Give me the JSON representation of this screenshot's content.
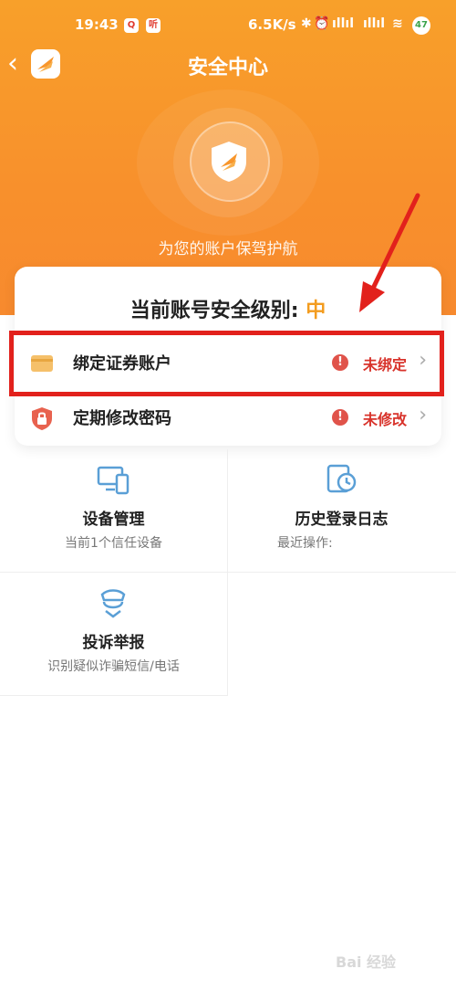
{
  "status_bar": {
    "time": "19:43",
    "badge_a": "Q",
    "badge_b": "听",
    "network_speed": "6.5K/s",
    "icons": [
      "bluetooth-icon",
      "alarm-icon",
      "signal-icon",
      "signal-icon",
      "wifi-icon"
    ],
    "battery": "47"
  },
  "nav": {
    "title": "安全中心",
    "back_icon": "chevron-left-icon"
  },
  "hero": {
    "subtitle": "为您的账户保驾护航"
  },
  "security_level": {
    "label": "当前账号安全级别: ",
    "value": "中"
  },
  "rows": [
    {
      "label": "绑定证券账户",
      "status": "未绑定",
      "icon": "card-icon"
    },
    {
      "label": "定期修改密码",
      "status": "未修改",
      "icon": "lock-shield-icon"
    }
  ],
  "grid": [
    {
      "title": "设备管理",
      "subtitle": "当前1个信任设备",
      "icon": "devices-icon"
    },
    {
      "title": "历史登录日志",
      "subtitle": "最近操作:",
      "icon": "history-clock-icon"
    },
    {
      "title": "投诉举报",
      "subtitle": "识别疑似诈骗短信/电话",
      "icon": "police-badge-icon"
    }
  ],
  "watermark": "Bai 经验",
  "colors": {
    "brand_orange": "#f8962c",
    "level_orange": "#f39c1f",
    "warn_red": "#d8332b",
    "highlight_red": "#e2211c",
    "icon_blue": "#5a9fd6"
  }
}
